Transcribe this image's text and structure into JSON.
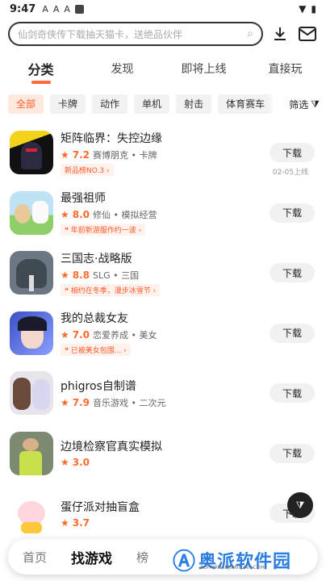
{
  "status": {
    "time": "9:47",
    "icons": [
      "A",
      "A",
      "A"
    ]
  },
  "search": {
    "placeholder": "仙剑奇侠传下载抽天猫卡，送绝品伙伴"
  },
  "tabs": [
    {
      "label": "分类",
      "active": true
    },
    {
      "label": "发现"
    },
    {
      "label": "即将上线"
    },
    {
      "label": "直接玩"
    }
  ],
  "chips": [
    "全部",
    "卡牌",
    "动作",
    "单机",
    "射击",
    "体育赛车"
  ],
  "filter_label": "筛选",
  "games": [
    {
      "name": "矩阵临界：失控边缘",
      "score": "7.2",
      "tags": "赛博朋克 • 卡牌",
      "badge": "新品榜NO.3 ›",
      "button": "下载",
      "sub": "02-05上线"
    },
    {
      "name": "最强祖师",
      "score": "8.0",
      "tags": "修仙 • 模拟经营",
      "badge": "❝ 年前新游服作约一波 ›",
      "button": "下载"
    },
    {
      "name": "三国志·战略版",
      "score": "8.8",
      "tags": "SLG • 三国",
      "badge": "❝ 相约在冬季，漫步冰雪节 ›",
      "button": "下载"
    },
    {
      "name": "我的总裁女友",
      "score": "7.0",
      "tags": "恋爱养成 • 美女",
      "badge": "❝ 已被美女包围... ›",
      "button": "下载"
    },
    {
      "name": "phigros自制谱",
      "score": "7.9",
      "tags": "音乐游戏 • 二次元",
      "badge": "",
      "button": "下载"
    },
    {
      "name": "边境检察官真实模拟",
      "score": "3.0",
      "tags": "",
      "badge": "",
      "button": "下载"
    },
    {
      "name": "蛋仔派对抽盲盒",
      "score": "3.7",
      "tags": "",
      "badge": "",
      "button": "下载"
    }
  ],
  "bottom_nav": [
    {
      "label": "首页"
    },
    {
      "label": "找游戏",
      "active": true
    },
    {
      "label": "榜"
    }
  ],
  "watermark": {
    "text": "奥派软件园",
    "url": "AOPAIRUANJIANYUAN.COM"
  },
  "colors": {
    "accent": "#ff6a3d",
    "watermark": "#2a7de1"
  }
}
